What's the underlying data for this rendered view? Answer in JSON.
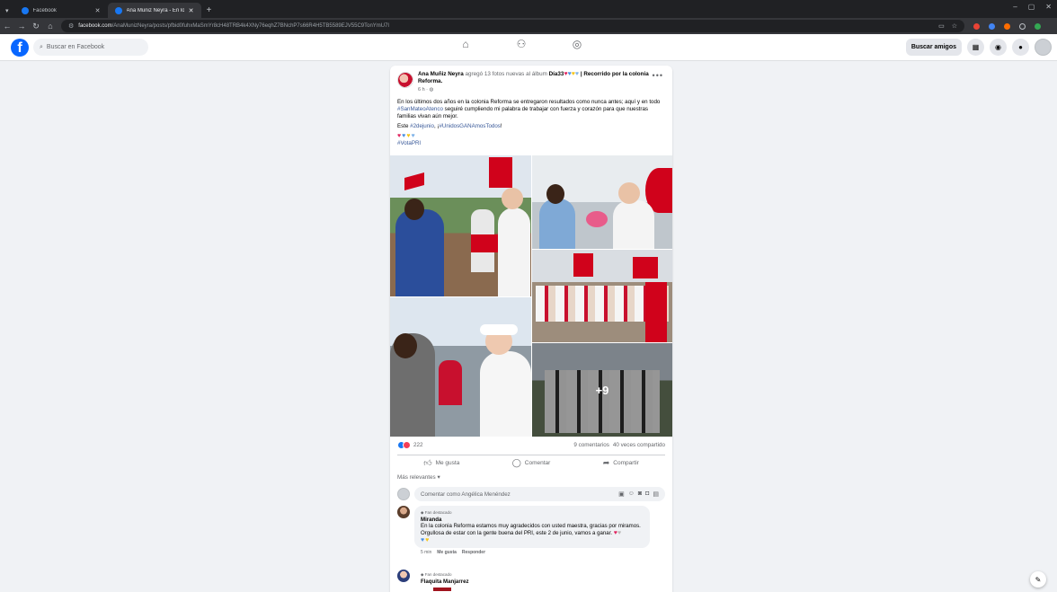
{
  "browser": {
    "tabs": [
      {
        "title": "Facebook"
      },
      {
        "title": "Ana Muñiz Neyra - En los últim..."
      }
    ],
    "new_tab": "+",
    "url_host": "facebook.com",
    "url_path": "/AnaMunizNeyra/posts/pfbid0fuhxMaSmYr8cH48TRB4k4XNy76eqhZ7BNchP7s66R4H5TB5589EJV55C9TonYmU7l"
  },
  "fb": {
    "search_placeholder": "Buscar en Facebook",
    "find_friends": "Buscar amigos"
  },
  "post": {
    "author": "Ana Muñiz Neyra",
    "action": "agregó 13 fotos nuevas al álbum",
    "album": "Día33",
    "album_rest": "| Recorrido por la colonia Reforma.",
    "time": "6 h ·",
    "text1": "En los últimos dos años en la colonia Reforma se entregaron resultados como nunca antes; aquí y en todo",
    "hashtag1": "#SanMateoAtenco",
    "text1b": "seguiré cumpliendo mi palabra de trabajar con fuerza y corazón para que nuestras familias vivan aún mejor.",
    "text2": "Este",
    "hashtag2": "#2dejunio",
    "text2b": ", ¡",
    "hashtag3": "#UnidosGANAmosTodos",
    "text2c": "!",
    "hashtag4": "#VotaPRI",
    "more_photos": "+9",
    "reactions_count": "222",
    "comments_count": "9 comentarios",
    "shares_count": "40 veces compartido",
    "like_label": "Me gusta",
    "comment_label": "Comentar",
    "share_label": "Compartir",
    "sort_label": "Más relevantes",
    "comment_placeholder": "Comentar como Angélica Menéndez"
  },
  "comments": [
    {
      "badge": "Fan destacado",
      "name": "Miranda",
      "line1": "En la colonia Reforma estamos muy agradecidos con usted maestra, gracias por miramos.",
      "line2": "Orgullosa de estar con la gente buena del PRI, este 2 de junio, vamos a ganar.",
      "time": "5 min",
      "like": "Me gusta",
      "reply": "Responder"
    },
    {
      "badge": "Fan destacado",
      "name": "Flaquita Manjarrez"
    }
  ],
  "colors": {
    "fb_blue": "#0866ff",
    "link": "#385898",
    "pri_red": "#c8102e",
    "pri_green": "#0a8a3c"
  }
}
